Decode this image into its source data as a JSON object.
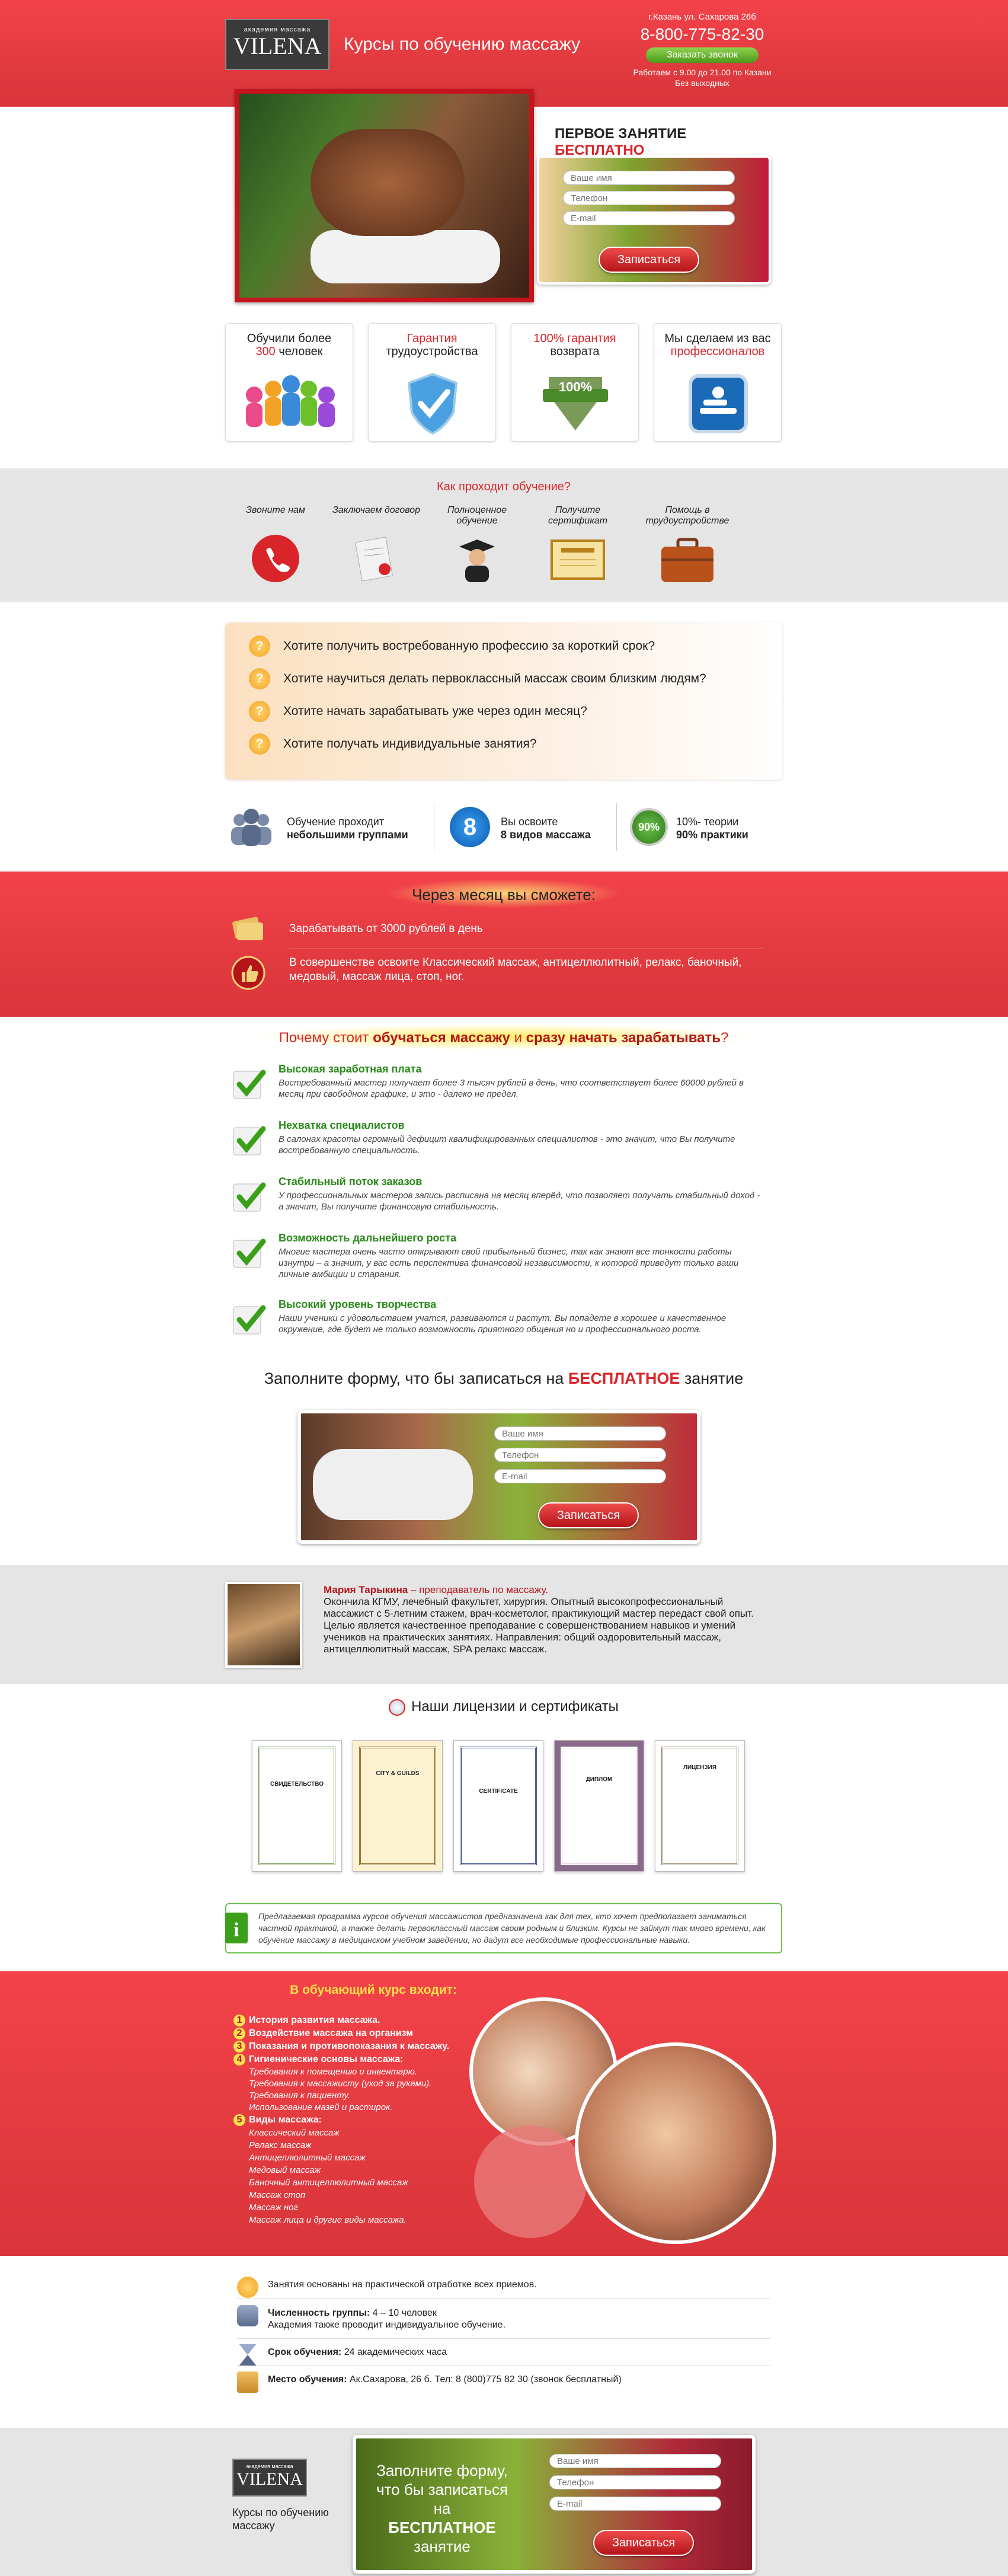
{
  "header": {
    "logo_top": "академия массажа",
    "logo": "VILENA",
    "title": "Курсы по обучению массажу",
    "address": "г.Казань ул. Сахарова 26б",
    "phone": "8-800-775-82-30",
    "callback_button": "Заказать звонок",
    "hours": "Работаем с 9.00 до 21.00 по Казани",
    "weekends": "Без выходных"
  },
  "hero_form": {
    "title_a": "ПЕРВОЕ ЗАНЯТИЕ ",
    "title_b": "БЕСПЛАТНО",
    "name_placeholder": "Ваше имя",
    "phone_placeholder": "Телефон",
    "email_placeholder": "E-mail",
    "submit": "Записаться"
  },
  "features": [
    {
      "a": "Обучили более",
      "b": "300",
      "c": " человек",
      "icon": "people-icon"
    },
    {
      "a": "Гарантия",
      "b": "",
      "c": "трудоустройства",
      "icon": "shield-check-icon"
    },
    {
      "a": "100% гарантия",
      "b": "",
      "c": "возврата",
      "icon": "badge-100-icon"
    },
    {
      "a": "Мы сделаем из вас",
      "b": "",
      "c": "профессионалов",
      "icon": "massage-sign-icon"
    }
  ],
  "process": {
    "title": "Как проходит обучение?",
    "steps": [
      {
        "label": "Звоните нам",
        "icon": "phone-icon"
      },
      {
        "label": "Заключаем договор",
        "icon": "contract-icon"
      },
      {
        "label": "Полноценное обучение",
        "icon": "graduate-icon"
      },
      {
        "label": "Получите сертификат",
        "icon": "certificate-icon"
      },
      {
        "label": "Помощь в трудоустройстве",
        "icon": "briefcase-icon"
      }
    ]
  },
  "questions": [
    "Хотите получить востребованную профессию за короткий срок?",
    "Хотите научиться делать первоклассный массаж своим близким людям?",
    "Хотите начать зарабатывать уже через один месяц?",
    "Хотите получать индивидуальные занятия?"
  ],
  "stats": [
    {
      "a": "Обучение проходит",
      "b": "небольшими группами",
      "icon": "group-icon"
    },
    {
      "a": "Вы освоите",
      "b": "8 видов массажа",
      "icon": "number-8-icon",
      "badge": "8"
    },
    {
      "a": "10%- теории",
      "b": "90% практики",
      "icon": "badge-90-icon",
      "badge": "90%"
    }
  ],
  "month": {
    "title": "Через месяц вы сможете:",
    "items": [
      "Зарабатывать от 3000 рублей в день",
      "В совершенстве освоите Классический массаж, антицеллюлитный, релакс, баночный, медовый, массаж лица, стоп, ног."
    ]
  },
  "why": {
    "title_a": "Почему стоит ",
    "title_b": "обучаться массажу",
    "title_c": " и ",
    "title_d": "сразу начать зарабатывать",
    "title_e": "?",
    "items": [
      {
        "h": "Высокая заработная плата",
        "p": "Востребованный мастер получает более 3 тысяч рублей в день, что соответствует более 60000 рублей в месяц при свободном графике, и это - далеко не предел."
      },
      {
        "h": "Нехватка специалистов",
        "p": "В салонах красоты огромный дефицит квалифицированных специалистов - это значит, что Вы получите востребованную специальность."
      },
      {
        "h": "Стабильный поток заказов",
        "p": "У профессиональных мастеров запись расписана на месяц вперёд, что позволяет получать стабильный доход - а значит, Вы получите финансовую стабильность."
      },
      {
        "h": "Возможность дальнейшего роста",
        "p": "Многие мастера очень часто открывают свой прибыльный бизнес, так как знают все тонкости работы изнутри – а значит, у вас есть перспектива финансовой независимости, к которой приведут только ваши личные амбиции и старания."
      },
      {
        "h": "Высокий уровень творчества",
        "p": "Наши ученики с удовольствием учатся, развиваются и растут. Вы попадете в хорошее и качественное окружение, где будет не только возможность приятного общения но и профессионального роста."
      }
    ]
  },
  "form2": {
    "title_a": "Заполните форму, что бы записаться на ",
    "title_b": "БЕСПЛАТНОЕ",
    "title_c": " занятие",
    "name_placeholder": "Ваше имя",
    "phone_placeholder": "Телефон",
    "email_placeholder": "E-mail",
    "submit": "Записаться"
  },
  "teacher": {
    "name": "Мария Тарыкина",
    "role": " – преподаватель по массажу.",
    "bio": "Окончила КГМУ, лечебный факультет, хирургия. Опытный высокопрофессиональный массажист с 5-летним стажем, врач-косметолог, практикующий мастер передаст свой опыт. Целью является качественное преподавание с совершенствованием навыков и умений учеников на практических занятиях. Направления: общий оздоровительный массаж, антицеллюлитный массаж, SPA релакс массаж."
  },
  "licenses": {
    "title": "Наши лицензии и сертификаты",
    "items": [
      "СВИДЕТЕЛЬСТВО",
      "CITY & GUILDS",
      "CERTIFICATE",
      "ДИПЛОМ",
      "ЛИЦЕНЗИЯ"
    ]
  },
  "note": "Предлагаемая программа курсов обучения массажистов предназначена как для тех, кто хочет предполагает заниматься частной практикой, а также делать первоклассный массаж своим родным и близким. Курсы не займут так много времени, как обучение массажу в медицинском учебном заведении, но дадут все необходимые профессиональные навыки.",
  "course": {
    "title": "В обучающий курс входит:",
    "items": [
      {
        "n": "1",
        "t": "История развития массажа."
      },
      {
        "n": "2",
        "t": "Воздействие массажа на организм"
      },
      {
        "n": "3",
        "t": "Показания и противопоказания к массажу."
      },
      {
        "n": "4",
        "t": "Гигиенические основы массажа:"
      }
    ],
    "hygiene": [
      "Требования к помещению и инвентарю.",
      "Требования к массажисту (уход за руками).",
      "Требования к пациенту.",
      "Использование мазей и растирок."
    ],
    "types_n": "5",
    "types_title": "Виды массажа:",
    "types": [
      "Классический массаж",
      "Релакс массаж",
      "Антицеллюлитный массаж",
      "Медовый массаж",
      "Баночный антицеллюлитный массаж",
      "Массаж стоп",
      "Массаж ног",
      "Массаж лица и другие виды массажа."
    ]
  },
  "info": [
    {
      "a": "Занятия основаны на практической отработке всех приемов.",
      "b": "",
      "icon": "thumbs-up-icon"
    },
    {
      "a": "Численность группы:",
      "b": " 4 – 10 человек",
      "c": "Академия также проводит индивидуальное обучение.",
      "icon": "group-icon"
    },
    {
      "a": "Срок обучения:",
      "b": " 24 академических часа",
      "icon": "hourglass-icon"
    },
    {
      "a": "Место обучения:",
      "b": " Ак.Сахарова, 26 б. Тел: 8 (800)775 82 30 (звонок бесплатный)",
      "icon": "building-icon"
    }
  ],
  "footer": {
    "logo_top": "академия массажа",
    "logo": "VILENA",
    "tagline": "Курсы по обучению массажу",
    "form_a": "Заполните форму,",
    "form_b": "что бы записаться на",
    "form_c": "БЕСПЛАТНОЕ",
    "form_d": "занятие",
    "name_placeholder": "Ваше имя",
    "phone_placeholder": "Телефон",
    "email_placeholder": "E-mail",
    "submit": "Записаться"
  }
}
